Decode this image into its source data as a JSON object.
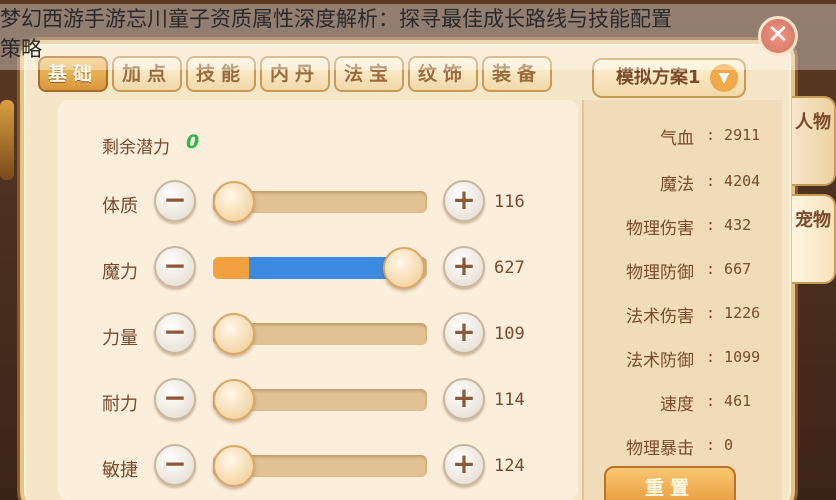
{
  "overlay_title": {
    "line1": "梦幻西游手游忘川童子资质属性深度解析：探寻最佳成长路线与技能配置",
    "line2": "策略"
  },
  "close": {
    "icon": "close-icon",
    "glyph": "✕"
  },
  "tabs": [
    {
      "label": "基础",
      "active": true
    },
    {
      "label": "加点",
      "active": false
    },
    {
      "label": "技能",
      "active": false
    },
    {
      "label": "内丹",
      "active": false
    },
    {
      "label": "法宝",
      "active": false
    },
    {
      "label": "纹饰",
      "active": false
    },
    {
      "label": "装备",
      "active": false
    }
  ],
  "potential": {
    "label": "剩余潜力",
    "value": "0"
  },
  "stats": [
    {
      "name": "体质",
      "value": "116",
      "minus": "−",
      "plus": "+",
      "base_fraction": 0.08,
      "added_fraction": 0.0
    },
    {
      "name": "魔力",
      "value": "627",
      "minus": "−",
      "plus": "+",
      "base_fraction": 0.17,
      "added_fraction": 0.73
    },
    {
      "name": "力量",
      "value": "109",
      "minus": "−",
      "plus": "+",
      "base_fraction": 0.07,
      "added_fraction": 0.0
    },
    {
      "name": "耐力",
      "value": "114",
      "minus": "−",
      "plus": "+",
      "base_fraction": 0.08,
      "added_fraction": 0.0
    },
    {
      "name": "敏捷",
      "value": "124",
      "minus": "−",
      "plus": "+",
      "base_fraction": 0.09,
      "added_fraction": 0.0
    }
  ],
  "scheme": {
    "label": "模拟方案1",
    "chevron": "▼"
  },
  "attributes": [
    {
      "name": "气血",
      "value": ": 2911"
    },
    {
      "name": "魔法",
      "value": ": 4204"
    },
    {
      "name": "物理伤害",
      "value": ": 432"
    },
    {
      "name": "物理防御",
      "value": ": 667"
    },
    {
      "name": "法术伤害",
      "value": ": 1226"
    },
    {
      "name": "法术防御",
      "value": ": 1099"
    },
    {
      "name": "速度",
      "value": ": 461"
    },
    {
      "name": "物理暴击",
      "value": ": 0"
    }
  ],
  "reset_label": "重置",
  "side_tabs": [
    {
      "label": "人物",
      "active": false
    },
    {
      "label": "宠物",
      "active": true
    }
  ],
  "colors": {
    "base_fill": "#f2a040",
    "added_fill": "#3a8ae0",
    "potential": "#2cb84a"
  }
}
